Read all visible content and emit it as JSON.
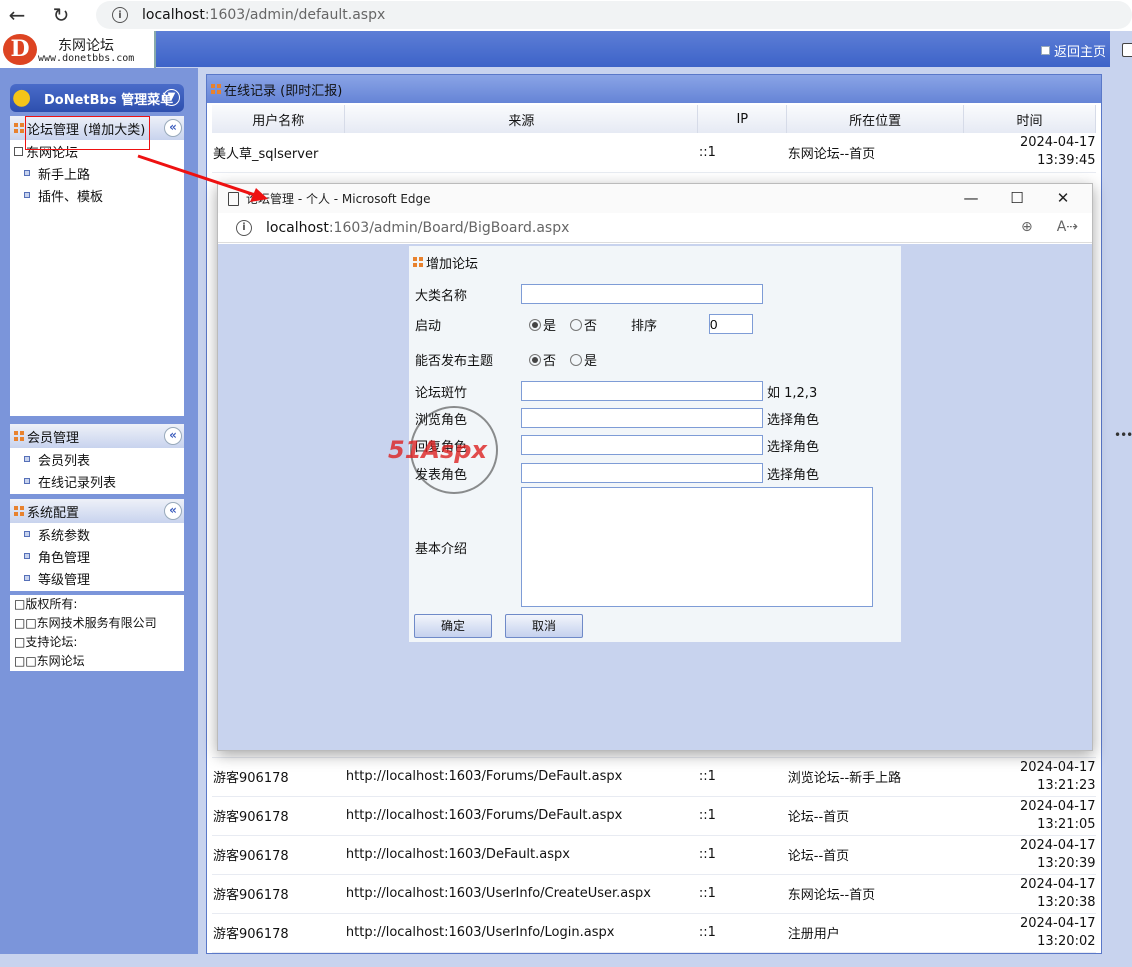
{
  "browser": {
    "url_host": "localhost",
    "url_path": ":1603/admin/default.aspx"
  },
  "site": {
    "logo_title": "东网论坛",
    "logo_url": "www.donetbbs.com",
    "return_home": "返回主页"
  },
  "sidebar": {
    "menu_title": "DoNetBbs 管理菜单",
    "forum_section": {
      "title": "论坛管理 (增加大类)",
      "root": "东网论坛",
      "items": [
        "新手上路",
        "插件、模板"
      ]
    },
    "member_section": {
      "title": "会员管理",
      "items": [
        "会员列表",
        "在线记录列表"
      ]
    },
    "system_section": {
      "title": "系统配置",
      "items": [
        "系统参数",
        "角色管理",
        "等级管理"
      ]
    },
    "footer_lines": [
      "□版权所有:",
      "□□东网技术服务有限公司",
      "□支持论坛:",
      "□□东网论坛"
    ]
  },
  "main": {
    "title": "在线记录 (即时汇报)",
    "columns": [
      "用户名称",
      "来源",
      "IP",
      "所在位置",
      "时间"
    ],
    "rows_top": [
      {
        "user": "美人草_sqlserver",
        "source": "",
        "ip": "::1",
        "location": "东网论坛--首页",
        "date": "2024-04-17",
        "time": "13:39:45"
      }
    ],
    "rows_bottom": [
      {
        "user": "游客906178",
        "source": "http://localhost:1603/Forums/DeFault.aspx",
        "ip": "::1",
        "location": "浏览论坛--新手上路",
        "date": "2024-04-17",
        "time": "13:21:23"
      },
      {
        "user": "游客906178",
        "source": "http://localhost:1603/Forums/DeFault.aspx",
        "ip": "::1",
        "location": "论坛--首页",
        "date": "2024-04-17",
        "time": "13:21:05"
      },
      {
        "user": "游客906178",
        "source": "http://localhost:1603/DeFault.aspx",
        "ip": "::1",
        "location": "论坛--首页",
        "date": "2024-04-17",
        "time": "13:20:39"
      },
      {
        "user": "游客906178",
        "source": "http://localhost:1603/UserInfo/CreateUser.aspx",
        "ip": "::1",
        "location": "东网论坛--首页",
        "date": "2024-04-17",
        "time": "13:20:38"
      },
      {
        "user": "游客906178",
        "source": "http://localhost:1603/UserInfo/Login.aspx",
        "ip": "::1",
        "location": "注册用户",
        "date": "2024-04-17",
        "time": "13:20:02"
      }
    ]
  },
  "popup": {
    "window_title": "论坛管理 - 个人 - Microsoft Edge",
    "url_host": "localhost",
    "url_path": ":1603/admin/Board/BigBoard.aspx",
    "form_title": "增加论坛",
    "fields": {
      "category_name_label": "大类名称",
      "category_name_value": "",
      "enabled_label": "启动",
      "enabled_yes": "是",
      "enabled_no": "否",
      "sort_label": "排序",
      "sort_value": "0",
      "can_post_label": "能否发布主题",
      "can_post_no": "否",
      "can_post_yes": "是",
      "moderators_label": "论坛斑竹",
      "moderators_hint": "如 1,2,3",
      "browse_role_label": "浏览角色",
      "reply_role_label": "回复角色",
      "post_role_label": "发表角色",
      "select_role_hint": "选择角色",
      "intro_label": "基本介绍"
    },
    "confirm_button": "确定",
    "cancel_button": "取消"
  },
  "watermark": {
    "text": "51Aspx"
  },
  "colors": {
    "page_bg": "#c8d3ee",
    "sidebar_bg": "#7b95da",
    "highlight_red": "#e11111",
    "field_border": "#7e9cd6"
  }
}
